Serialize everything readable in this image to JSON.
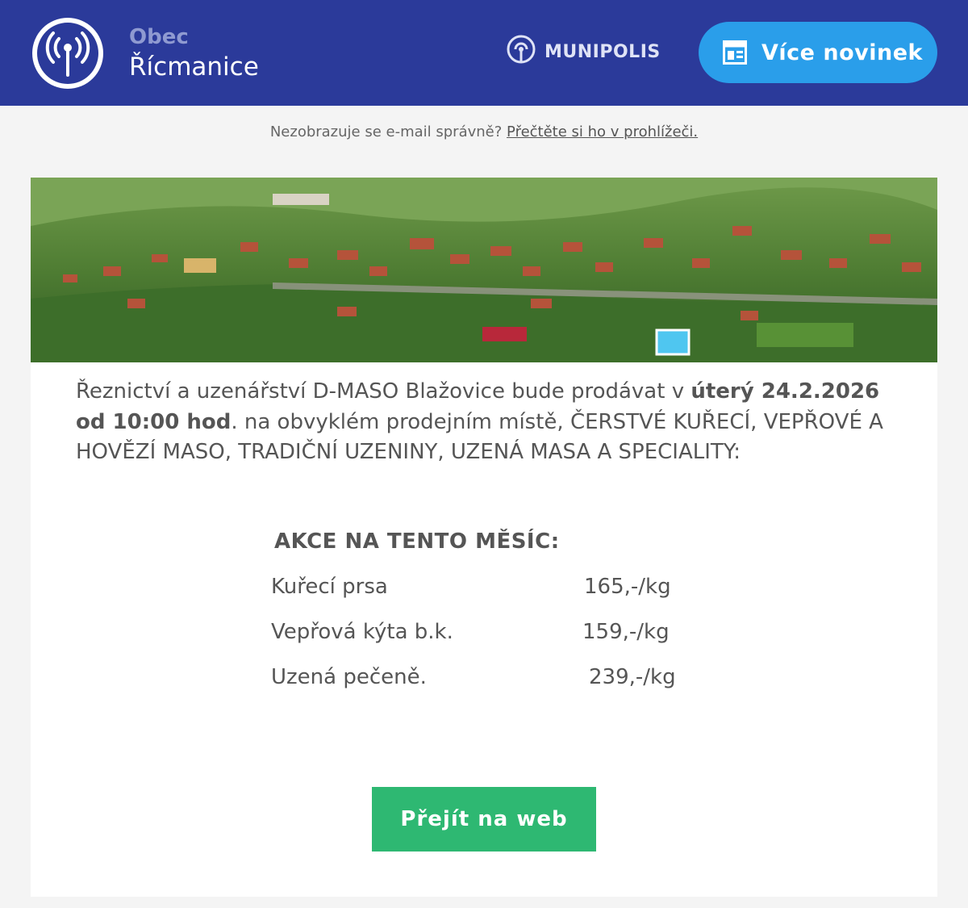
{
  "header": {
    "brand_small": "Obec",
    "brand_name": "Řícmanice",
    "provider": "MUNIPOLIS",
    "more_news_label": "Více novinek"
  },
  "notice": {
    "text": "Nezobrazuje se e-mail správně?",
    "link": "Přečtěte si ho v prohlížeči."
  },
  "article": {
    "intro_lead": "Řeznictví a uzenářství D-MASO Blažovice bude prodávat v ",
    "intro_when": "úterý 24.2.2026 od 10:00 hod",
    "intro_rest": ". na obvyklém prodejním místě, ČERSTVÉ KUŘECÍ, VEPŘOVÉ A HOVĚZÍ MASO, TRADIČNÍ UZENINY, UZENÁ MASA A SPECIALITY:",
    "offers_title": "AKCE NA TENTO MĚSÍC:",
    "offers": [
      {
        "name": "Kuřecí prsa",
        "price": "165,-/kg"
      },
      {
        "name": "Vepřová kýta b.k.",
        "price": "159,-/kg"
      },
      {
        "name": "Uzená pečeně.",
        "price": "239,-/kg"
      }
    ],
    "cta_label": "Přejít na web"
  },
  "colors": {
    "header_bg": "#2b3a9a",
    "button_blue": "#2a9eea",
    "button_green": "#2eb872",
    "text_gray": "#555555"
  },
  "icons": [
    "broadcast-icon",
    "munipolis-icon",
    "news-icon"
  ]
}
